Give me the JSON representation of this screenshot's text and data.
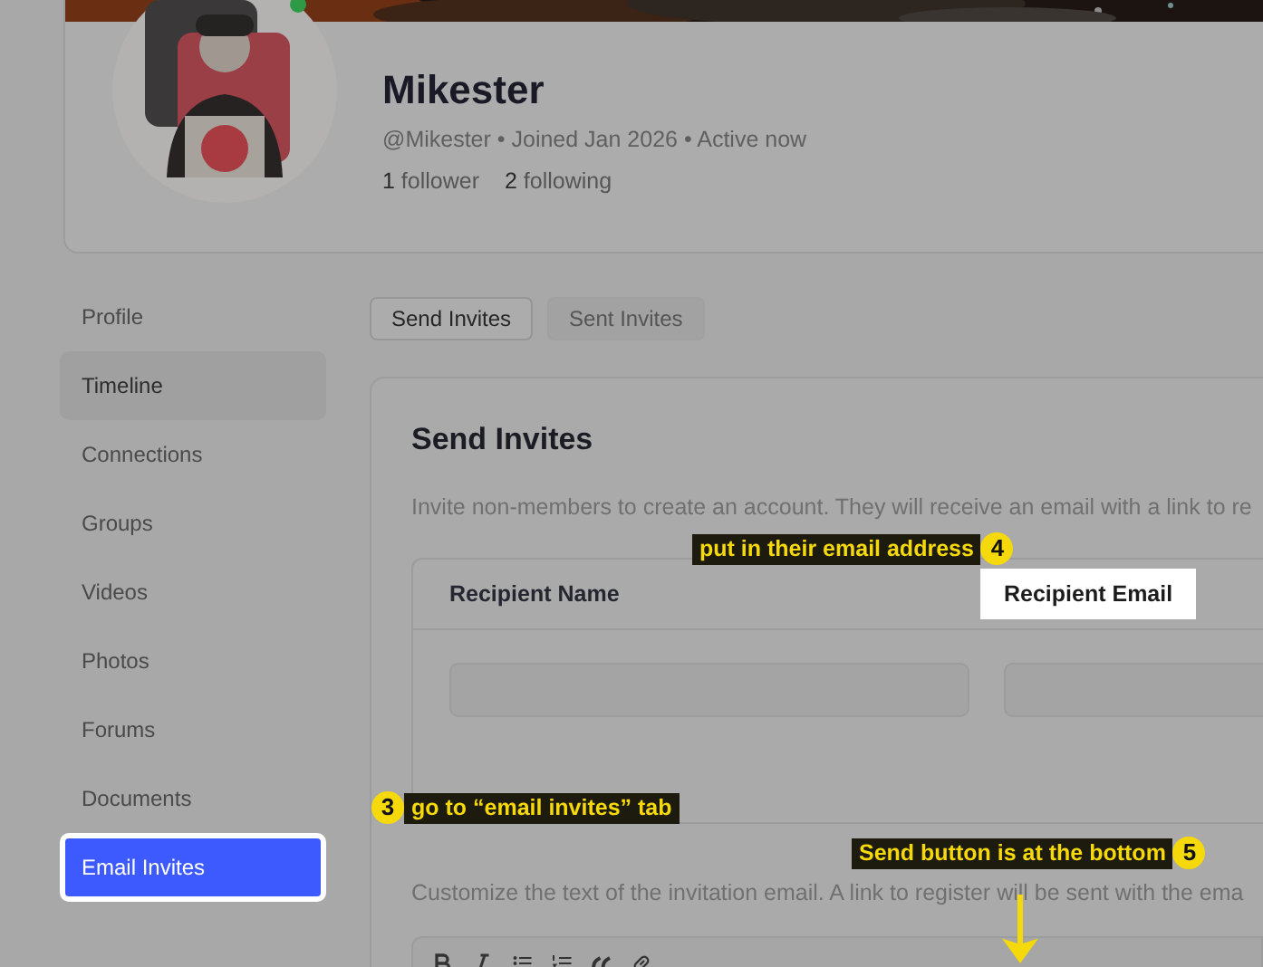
{
  "profile": {
    "name": "Mikester",
    "meta": "@Mikester • Joined Jan 2026 • Active now",
    "online": true,
    "stats": [
      {
        "count": "1",
        "label": "follower"
      },
      {
        "count": "2",
        "label": "following"
      }
    ]
  },
  "sidebar": {
    "items": [
      {
        "label": "Profile",
        "selected": false,
        "hovered": false,
        "spotlight": false
      },
      {
        "label": "Timeline",
        "selected": false,
        "hovered": true,
        "spotlight": false
      },
      {
        "label": "Connections",
        "selected": false,
        "hovered": false,
        "spotlight": false
      },
      {
        "label": "Groups",
        "selected": false,
        "hovered": false,
        "spotlight": false
      },
      {
        "label": "Videos",
        "selected": false,
        "hovered": false,
        "spotlight": false
      },
      {
        "label": "Photos",
        "selected": false,
        "hovered": false,
        "spotlight": false
      },
      {
        "label": "Forums",
        "selected": false,
        "hovered": false,
        "spotlight": false
      },
      {
        "label": "Documents",
        "selected": false,
        "hovered": false,
        "spotlight": false
      },
      {
        "label": "Email Invites",
        "selected": true,
        "hovered": false,
        "spotlight": true
      }
    ]
  },
  "tabs": [
    {
      "label": "Send Invites",
      "selected": true
    },
    {
      "label": "Sent Invites",
      "selected": false
    }
  ],
  "invite_card": {
    "title": "Send Invites",
    "description": "Invite non-members to create an account. They will receive an email with a link to re",
    "table": {
      "columns": [
        {
          "label": "Recipient Name",
          "spotlight": false
        },
        {
          "label": "Recipient Email",
          "spotlight": true
        }
      ]
    },
    "message_hint": "Customize the text of the invitation email. A link to register will be sent with the ema",
    "toolbar": [
      {
        "kind": "bold"
      },
      {
        "kind": "italic"
      },
      {
        "kind": "bullet_list"
      },
      {
        "kind": "ordered_list"
      },
      {
        "kind": "quote"
      },
      {
        "kind": "link"
      }
    ]
  },
  "callouts": [
    {
      "number": "3",
      "text": "go to “email invites” tab",
      "kind": "badge_left"
    },
    {
      "number": "4",
      "text": "put in their email address",
      "kind": "badge_right"
    },
    {
      "number": "5",
      "text": "Send button is at the bottom",
      "kind": "badge_right_arrow"
    }
  ]
}
